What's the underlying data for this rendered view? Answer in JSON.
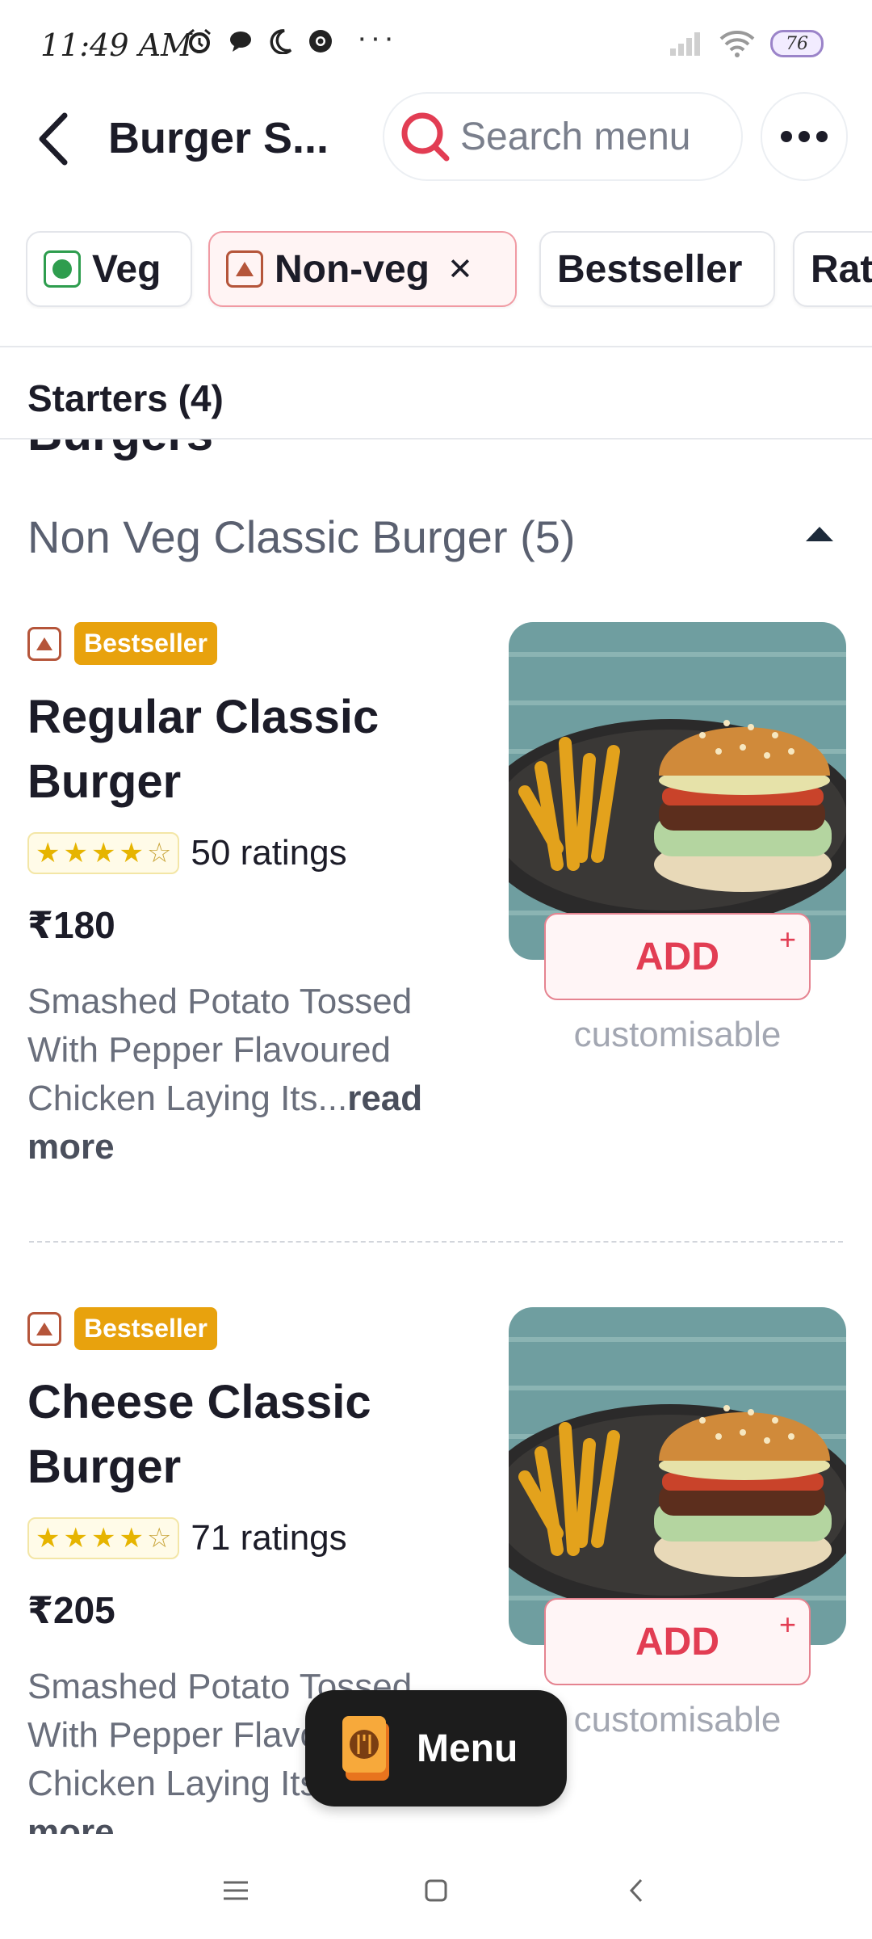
{
  "status_bar": {
    "time": "11:49 AM",
    "more": "···",
    "battery": "76"
  },
  "header": {
    "title": "Burger S...",
    "search_placeholder": "Search menu"
  },
  "filters": [
    {
      "label": "Veg"
    },
    {
      "label": "Non-veg",
      "close": "✕"
    },
    {
      "label": "Bestseller"
    },
    {
      "label": "Rat"
    }
  ],
  "sticky_section": "Starters (4)",
  "peek_section": "Burgers",
  "category": {
    "title": "Non Veg Classic Burger (5)"
  },
  "items": [
    {
      "badge": "Bestseller",
      "name": "Regular Classic Burger",
      "rating_text": "50 ratings",
      "stars": 4.0,
      "price": "₹180",
      "description": "Smashed Potato Tossed With Pepper Flavoured Chicken Laying Its...",
      "read_more": "read more",
      "add": "ADD",
      "plus": "+",
      "customisable": "customisable"
    },
    {
      "badge": "Bestseller",
      "name": "Cheese Classic Burger",
      "rating_text": "71 ratings",
      "stars": 4.5,
      "price": "₹205",
      "description": "Smashed Potato Tossed With Pepper Flavoured Chicken Laying Its...",
      "read_more": "read more",
      "add": "ADD",
      "plus": "+",
      "customisable": "customisable"
    }
  ],
  "menu_button": "Menu",
  "colors": {
    "accent_red": "#e23d53",
    "bestseller_bg": "#e8a20d",
    "veg_green": "#2e9d4e",
    "nonveg_brown": "#b5553a"
  }
}
